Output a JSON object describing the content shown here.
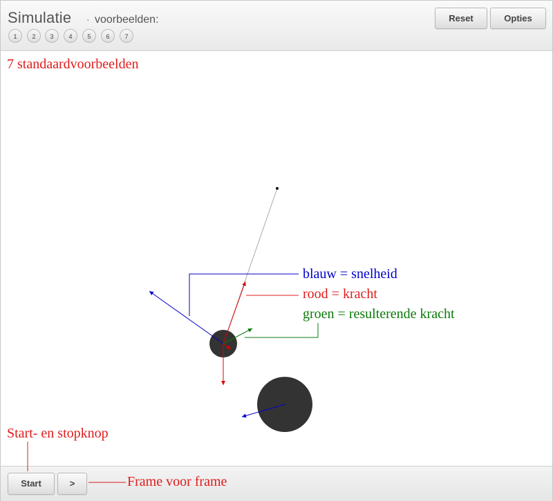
{
  "header": {
    "title": "Simulatie",
    "separator": "·",
    "subtitle": "voorbeelden:",
    "examples": [
      "1",
      "2",
      "3",
      "4",
      "5",
      "6",
      "7"
    ],
    "reset_label": "Reset",
    "options_label": "Opties"
  },
  "annotations": {
    "examples_note": "7 standaardvoorbeelden",
    "blue_legend": "blauw = snelheid",
    "red_legend": "rood = kracht",
    "green_legend": "groen = resulterende kracht",
    "start_note": "Start- en stopknop",
    "frame_note": "Frame voor frame"
  },
  "footer": {
    "start_label": "Start",
    "step_label": ">"
  },
  "colors": {
    "annotation_red": "#e01b1b",
    "velocity_blue": "#0000cc",
    "force_red": "#dd0000",
    "resultant_green": "#0a7a0a",
    "body_dark": "#333333"
  }
}
